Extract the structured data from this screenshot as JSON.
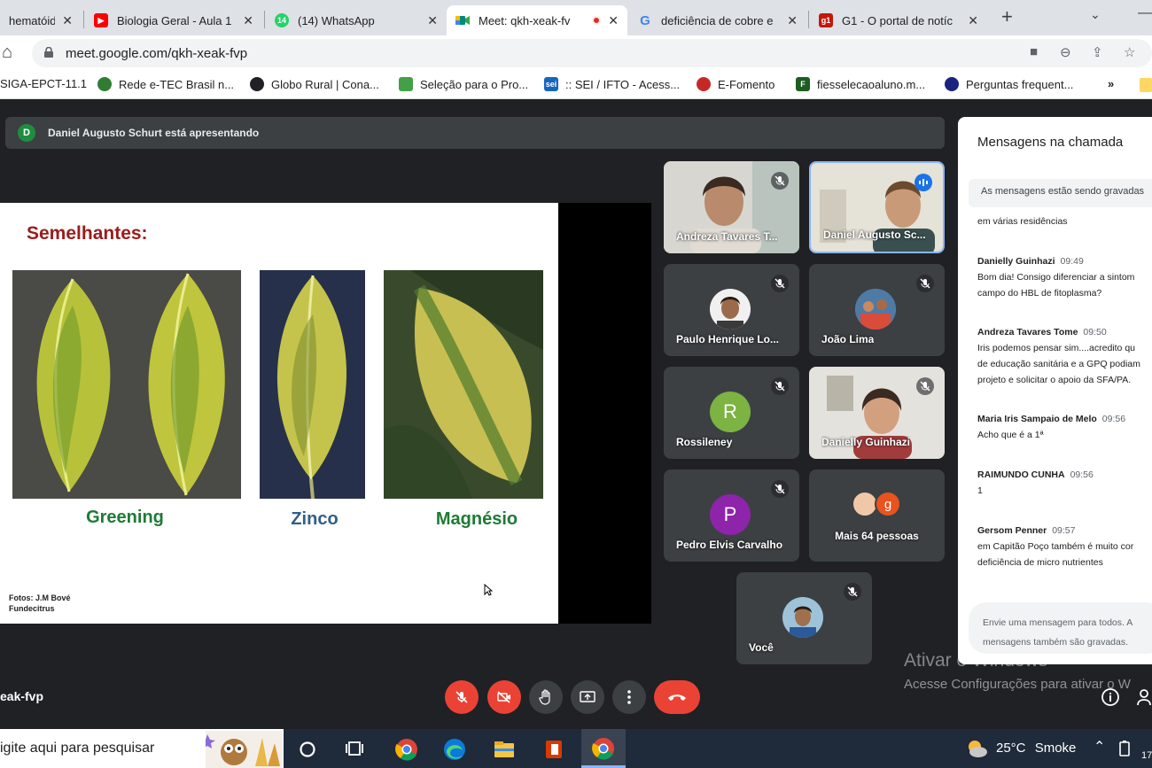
{
  "browser": {
    "tabs": [
      {
        "title": "hematóide",
        "icon": "document-icon",
        "color": "#5f6368"
      },
      {
        "title": "Biologia Geral - Aula 1",
        "icon": "youtube-icon",
        "color": "#ff0000"
      },
      {
        "title": "(14) WhatsApp",
        "icon": "whatsapp-icon",
        "color": "#25d366",
        "badge": "14"
      },
      {
        "title": "Meet: qkh-xeak-fv",
        "icon": "meet-icon",
        "color": "#00897b"
      },
      {
        "title": "deficiência de cobre e",
        "icon": "google-icon",
        "color": "#4285f4"
      },
      {
        "title": "G1 - O portal de notíc",
        "icon": "g1-icon",
        "color": "#c4170c",
        "badge": "g1"
      }
    ],
    "url": "meet.google.com/qkh-xeak-fvp",
    "bookmarks": [
      {
        "label": "SIGA-EPCT-11.1",
        "color": "#5f6368"
      },
      {
        "label": "Rede e-TEC Brasil n...",
        "color": "#2e7d32"
      },
      {
        "label": "Globo Rural | Cona...",
        "color": "#202124"
      },
      {
        "label": "Seleção para o Pro...",
        "color": "#43a047"
      },
      {
        "label": ":: SEI / IFTO - Acess...",
        "color": "#1565c0",
        "badge": "sei"
      },
      {
        "label": "E-Fomento",
        "color": "#c62828"
      },
      {
        "label": "fiesselecaoaluno.m...",
        "color": "#1b5e20",
        "badge": "F"
      },
      {
        "label": "Perguntas frequent...",
        "color": "#1a237e"
      }
    ],
    "more_bookmarks": "»"
  },
  "meet": {
    "presenter_initial": "D",
    "presenter_text": "Daniel Augusto Schurt está apresentando",
    "slide": {
      "title": "Semelhantes:",
      "captions": [
        "Greening",
        "Zinco",
        "Magnésio"
      ],
      "caption_colors": [
        "#1e7b34",
        "#2f5f8a",
        "#1e7b34"
      ],
      "credit_line1": "Fotos: J.M Bové",
      "credit_line2": "Fundecitrus"
    },
    "participants": [
      {
        "name": "Andreza Tavares T...",
        "type": "video"
      },
      {
        "name": "Daniel Augusto Sc...",
        "type": "video",
        "speaking": true
      },
      {
        "name": "Paulo Henrique Lo...",
        "type": "photo"
      },
      {
        "name": "João Lima",
        "type": "photo"
      },
      {
        "name": "Rossileney",
        "type": "initial",
        "initial": "R",
        "color": "#7cb342"
      },
      {
        "name": "Danielly Guinhazi",
        "type": "video"
      },
      {
        "name": "Pedro Elvis Carvalho",
        "type": "initial",
        "initial": "P",
        "color": "#8e24aa"
      },
      {
        "name": "Mais 64 pessoas",
        "type": "more",
        "initial": "g"
      },
      {
        "name": "Você",
        "type": "photo"
      }
    ],
    "chat": {
      "header": "Mensagens na chamada",
      "recording_notice": "As mensagens estão sendo gravadas",
      "first_line": "em várias residências",
      "messages": [
        {
          "author": "Danielly Guinhazi",
          "time": "09:49",
          "lines": [
            "Bom dia! Consigo diferenciar a sintom",
            "campo do HBL de fitoplasma?"
          ]
        },
        {
          "author": "Andreza Tavares Tome",
          "time": "09:50",
          "lines": [
            "Iris podemos pensar sim....acredito qu",
            "de educação sanitária e a GPQ podiam",
            "projeto e solicitar o apoio da SFA/PA."
          ]
        },
        {
          "author": "Maria Iris Sampaio de Melo",
          "time": "09:56",
          "lines": [
            "Acho que é a 1ª"
          ]
        },
        {
          "author": "RAIMUNDO CUNHA",
          "time": "09:56",
          "lines": [
            "1"
          ]
        },
        {
          "author": "Gersom Penner",
          "time": "09:57",
          "lines": [
            "em Capitão Poço também é muito cor",
            "deficiência de micro nutrientes"
          ]
        }
      ],
      "input_line1": "Envie uma mensagem para todos. A",
      "input_line2": "mensagens também são gravadas."
    },
    "meeting_code": "eak-fvp",
    "activation_title": "Ativar o Windows",
    "activation_text": "Acesse Configurações para ativar o W"
  },
  "taskbar": {
    "search_placeholder": "igite aqui para pesquisar",
    "temperature": "25°C",
    "weather": "Smoke",
    "clock": "17"
  }
}
